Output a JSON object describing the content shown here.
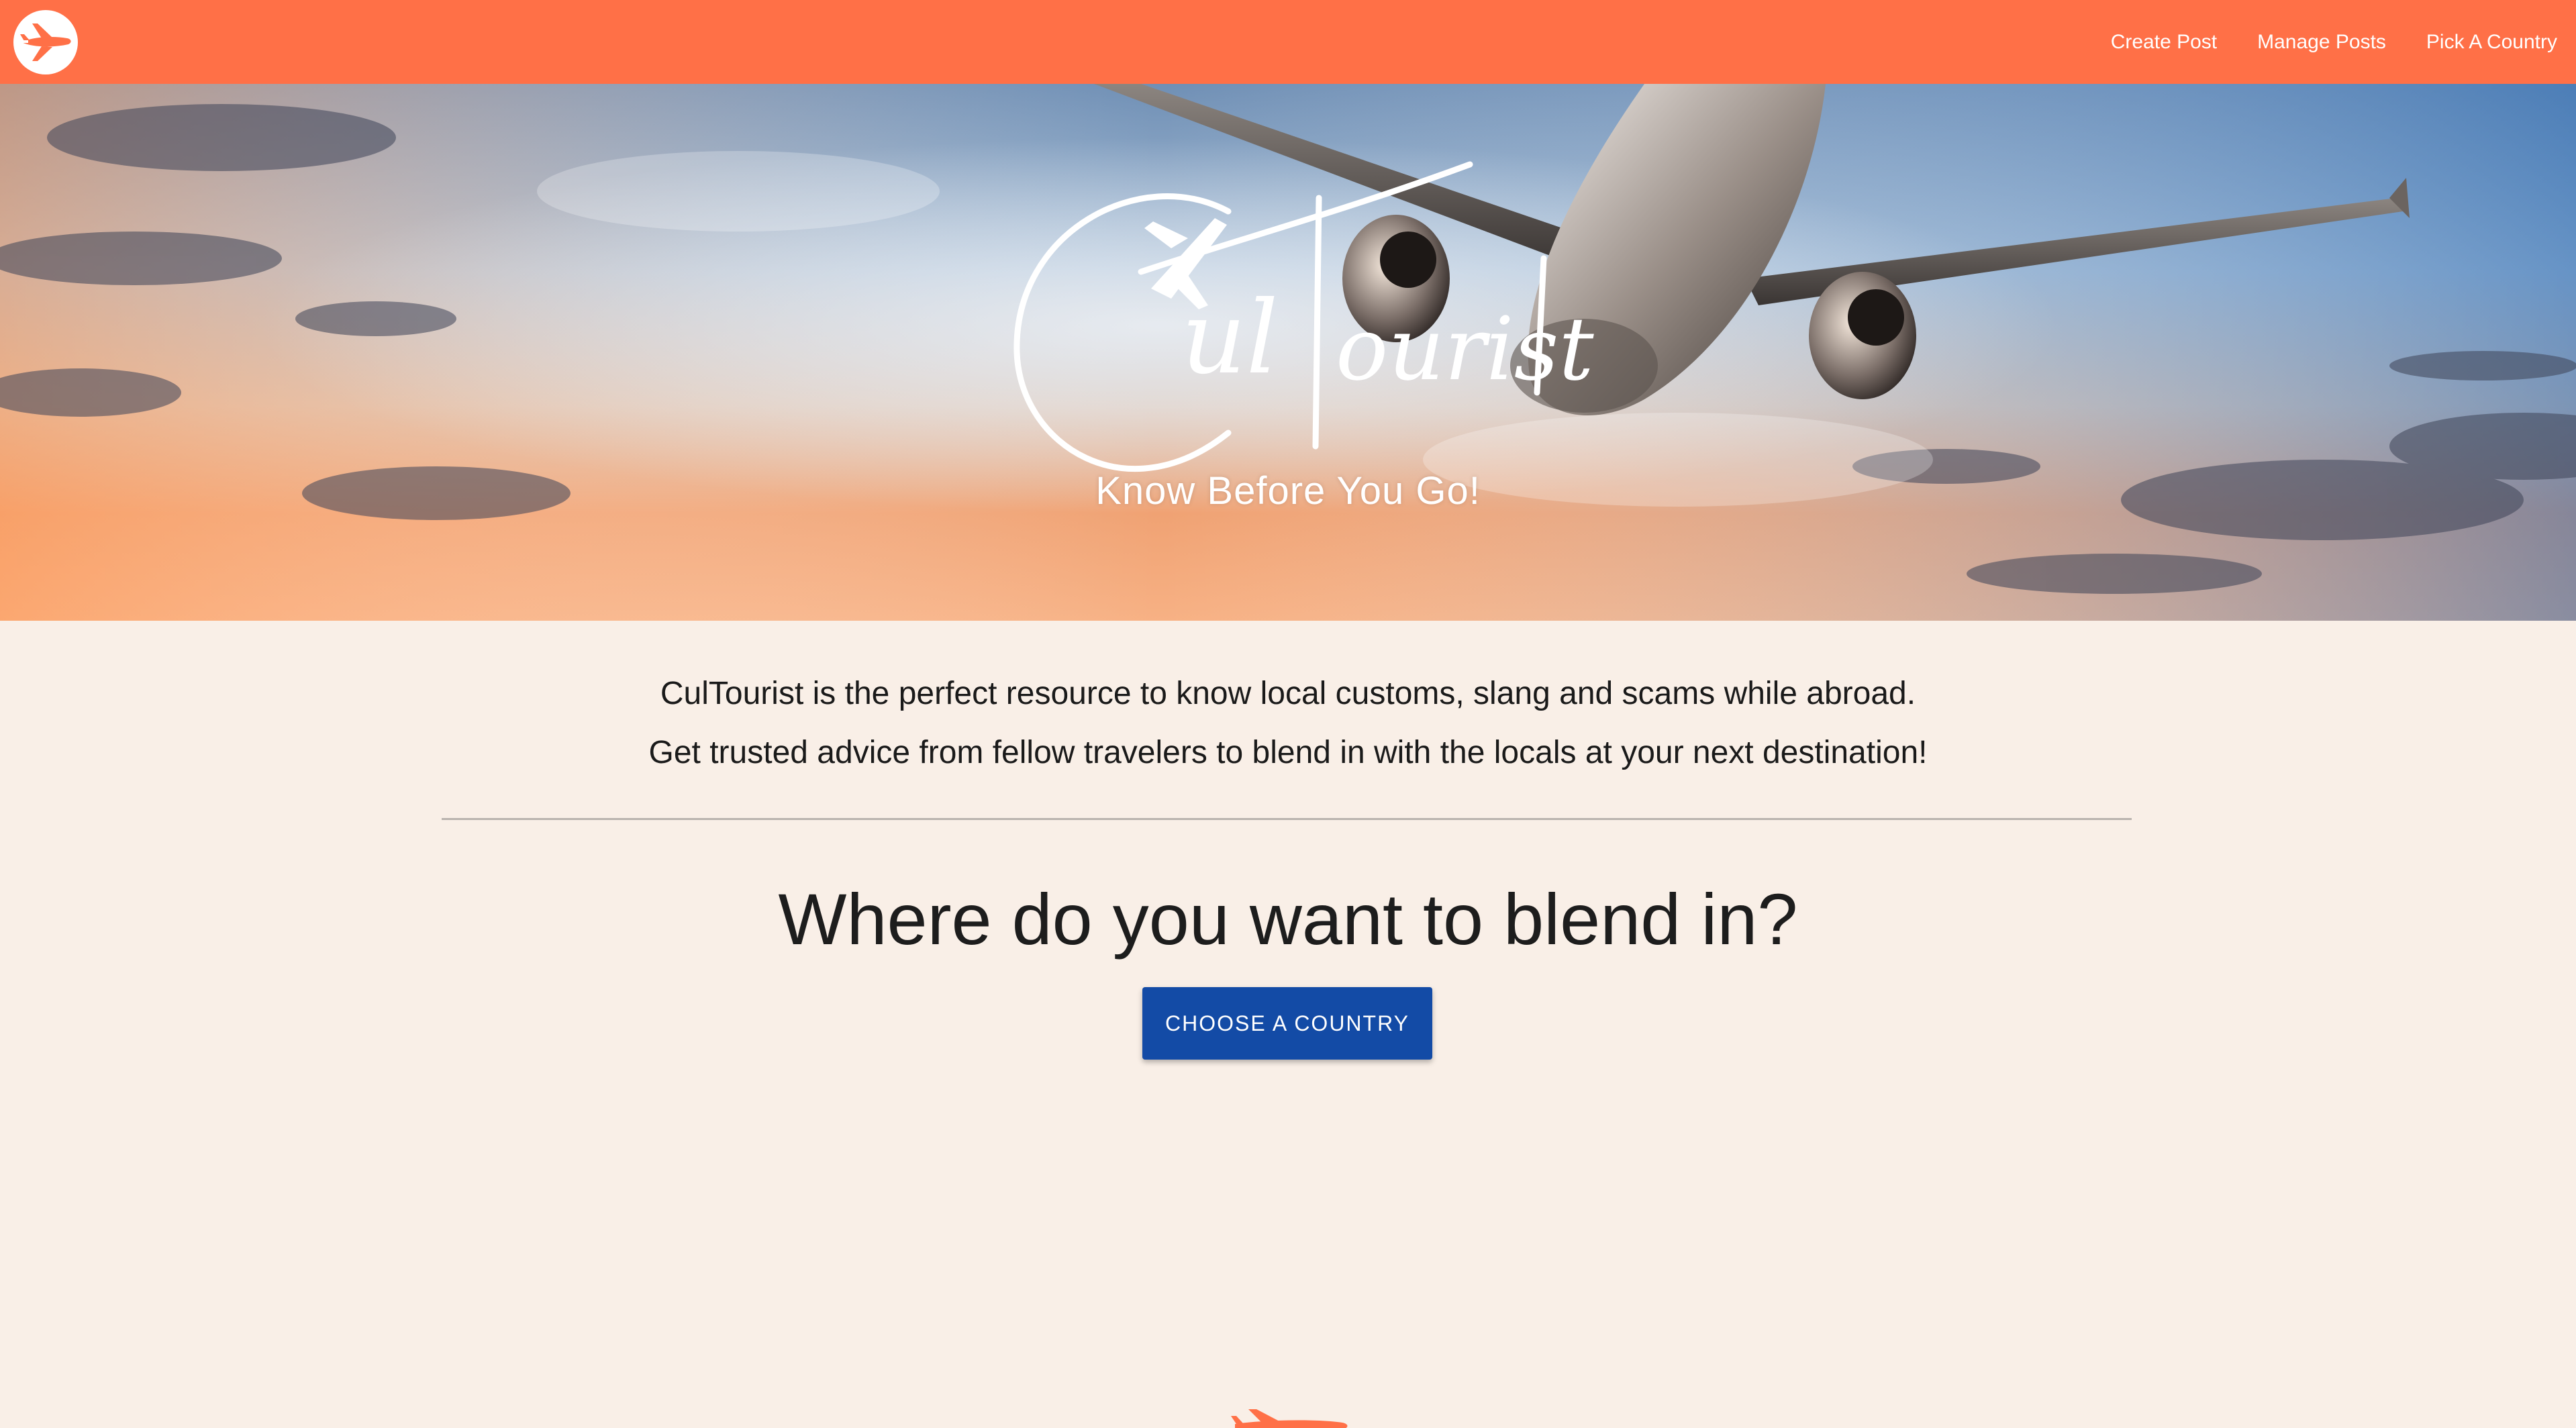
{
  "nav": {
    "links": [
      {
        "label": "Create Post"
      },
      {
        "label": "Manage Posts"
      },
      {
        "label": "Pick A Country"
      }
    ]
  },
  "hero": {
    "brand": "CulTourist",
    "tagline": "Know Before You Go!"
  },
  "intro": {
    "line1": "CulTourist is the perfect resource to know local customs, slang and scams while abroad.",
    "line2": "Get trusted advice from fellow travelers to blend in with the locals at your next destination!"
  },
  "prompt": {
    "heading": "Where do you want to blend in?",
    "button_label": "Choose a Country"
  },
  "colors": {
    "navbar": "#ff7047",
    "background": "#f9efe7",
    "button": "#134ba6",
    "text": "#1d1d1d"
  },
  "icons": {
    "logo": "airplane-circle-icon",
    "footer": "airplane-icon"
  }
}
